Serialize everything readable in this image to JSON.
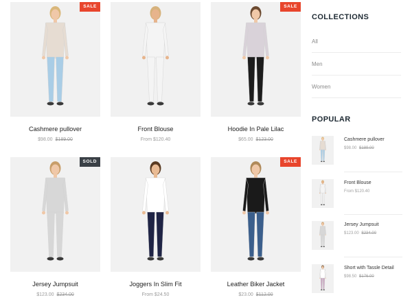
{
  "products": [
    {
      "name": "Cashmere pullover",
      "price": "$98.00",
      "old_price": "$189.00",
      "badge": "SALE",
      "badge_type": "sale",
      "figure": {
        "top": "#e6dcd2",
        "bottom": "#a9cde6",
        "skin": "#f0c8a8",
        "hair": "#d9b77a"
      }
    },
    {
      "name": "Front Blouse",
      "price": "From $120.40",
      "old_price": "",
      "badge": "",
      "badge_type": "",
      "figure": {
        "top": "#f4f4f4",
        "bottom": "#f4f4f4",
        "skin": "#e7b48c",
        "hair": "#d6b27c"
      }
    },
    {
      "name": "Hoodie In Pale Lilac",
      "price": "$65.00",
      "old_price": "$123.00",
      "badge": "SALE",
      "badge_type": "sale",
      "figure": {
        "top": "#d9d2d9",
        "bottom": "#1c1c1c",
        "skin": "#f0c8a8",
        "hair": "#6b4a30"
      }
    },
    {
      "name": "Jersey Jumpsuit",
      "price": "$123.00",
      "old_price": "$234.00",
      "badge": "SOLD",
      "badge_type": "sold",
      "figure": {
        "top": "#d7d7d7",
        "bottom": "#d7d7d7",
        "skin": "#f0c8a8",
        "hair": "#c89e6a"
      }
    },
    {
      "name": "Joggers In Slim Fit",
      "price": "From $24.50",
      "old_price": "",
      "badge": "",
      "badge_type": "",
      "figure": {
        "top": "#ffffff",
        "bottom": "#1f2445",
        "skin": "#e9bb94",
        "hair": "#5a3b22"
      }
    },
    {
      "name": "Leather Biker Jacket",
      "price": "$23.00",
      "old_price": "$112.00",
      "badge": "SALE",
      "badge_type": "sale",
      "figure": {
        "top": "#1a1a1a",
        "bottom": "#3b5f8c",
        "skin": "#f0c8a8",
        "hair": "#b08a5a"
      }
    }
  ],
  "collections": {
    "title": "COLLECTIONS",
    "items": [
      "All",
      "Men",
      "Women"
    ]
  },
  "popular": {
    "title": "POPULAR",
    "items": [
      {
        "name": "Cashmere pullover",
        "price": "$98.00",
        "old_price": "$189.00",
        "figure": {
          "top": "#e6dcd2",
          "bottom": "#a9cde6",
          "skin": "#f0c8a8",
          "hair": "#d9b77a"
        }
      },
      {
        "name": "Front Blouse",
        "price": "From $120.40",
        "old_price": "",
        "figure": {
          "top": "#f4f4f4",
          "bottom": "#f4f4f4",
          "skin": "#e7b48c",
          "hair": "#d6b27c"
        }
      },
      {
        "name": "Jersey Jumpsuit",
        "price": "$123.00",
        "old_price": "$234.00",
        "figure": {
          "top": "#d7d7d7",
          "bottom": "#d7d7d7",
          "skin": "#f0c8a8",
          "hair": "#c89e6a"
        }
      },
      {
        "name": "Short with Tassle Detail",
        "price": "$98.50",
        "old_price": "$176.00",
        "figure": {
          "top": "#ffffff",
          "bottom": "#c8a6c0",
          "skin": "#f0c8a8",
          "hair": "#7a5a3a"
        }
      }
    ]
  }
}
